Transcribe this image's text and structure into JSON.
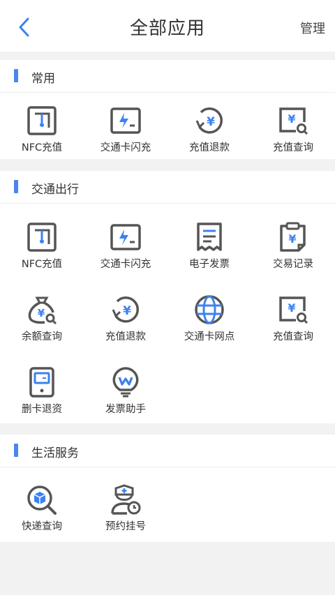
{
  "header": {
    "title": "全部应用",
    "manage_label": "管理",
    "back_icon": "chevron-left-icon"
  },
  "accent_color": "#4a86ec",
  "sections": [
    {
      "title": "常用",
      "items": [
        {
          "label": "NFC充值",
          "icon": "nfc-card-icon"
        },
        {
          "label": "交通卡闪充",
          "icon": "flash-charge-icon"
        },
        {
          "label": "充值退款",
          "icon": "refund-icon"
        },
        {
          "label": "充值查询",
          "icon": "recharge-query-icon"
        }
      ]
    },
    {
      "title": "交通出行",
      "items": [
        {
          "label": "NFC充值",
          "icon": "nfc-card-icon"
        },
        {
          "label": "交通卡闪充",
          "icon": "flash-charge-icon"
        },
        {
          "label": "电子发票",
          "icon": "receipt-icon"
        },
        {
          "label": "交易记录",
          "icon": "clipboard-yen-icon"
        },
        {
          "label": "余额查询",
          "icon": "money-bag-search-icon"
        },
        {
          "label": "充值退款",
          "icon": "refund-icon"
        },
        {
          "label": "交通卡网点",
          "icon": "globe-icon"
        },
        {
          "label": "充值查询",
          "icon": "recharge-query-icon"
        },
        {
          "label": "删卡退资",
          "icon": "phone-card-icon"
        },
        {
          "label": "发票助手",
          "icon": "lightbulb-icon"
        }
      ]
    },
    {
      "title": "生活服务",
      "items": [
        {
          "label": "快递查询",
          "icon": "package-search-icon"
        },
        {
          "label": "预约挂号",
          "icon": "doctor-clock-icon"
        }
      ]
    }
  ]
}
